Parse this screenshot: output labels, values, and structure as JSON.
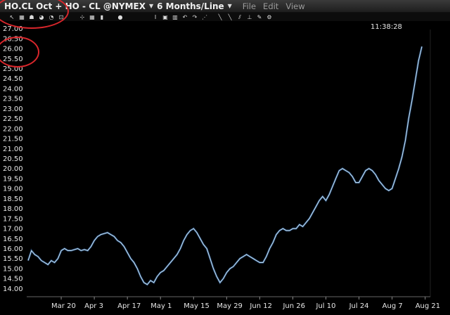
{
  "window": {
    "symbol": "HO.CL Oct + HO - CL @NYMEX",
    "period": "6 Months/Line",
    "menu": [
      "File",
      "Edit",
      "View"
    ]
  },
  "toolbar": {
    "icons": [
      "cursor-icon",
      "grid-icon",
      "drawing-icon",
      "paint-icon",
      "zoom-icon",
      "template-icon",
      "crosshair-icon",
      "table-icon",
      "bar-chart-icon",
      "globe-icon",
      "text-icon",
      "window-icon",
      "columns-icon",
      "undo-icon",
      "redo-icon",
      "trend-icon",
      "fib-icon",
      "line-icon",
      "channel-icon",
      "measure-icon",
      "tools-icon",
      "settings-icon"
    ]
  },
  "clock": "11:38:28",
  "colors": {
    "line": "#b9dbf5",
    "background": "#000000",
    "annotation": "#d8262b"
  },
  "chart_data": {
    "type": "line",
    "title": "",
    "xlabel": "",
    "ylabel": "",
    "ylim": [
      13.6,
      27.3
    ],
    "yticks": [
      14.0,
      14.5,
      15.0,
      15.5,
      16.0,
      16.5,
      17.0,
      17.5,
      18.0,
      18.5,
      19.0,
      19.5,
      20.0,
      20.5,
      21.0,
      21.5,
      22.0,
      22.5,
      23.0,
      23.5,
      24.0,
      24.5,
      25.0,
      25.5,
      26.0,
      26.5,
      27.0
    ],
    "ytick_labels": [
      "14.00",
      "14.50",
      "15.00",
      "15.50",
      "16.00",
      "16.50",
      "17.00",
      "17.50",
      "18.00",
      "18.50",
      "19.00",
      "19.50",
      "20.00",
      "20.50",
      "21.00",
      "21.50",
      "22.00",
      "22.50",
      "23.00",
      "23.50",
      "24.00",
      "24.50",
      "25.00",
      "25.50",
      "26.00",
      "26.50",
      "27.00"
    ],
    "xticks": [
      {
        "label": "Mar 20",
        "index": 10
      },
      {
        "label": "Apr 3",
        "index": 20
      },
      {
        "label": "Apr 17",
        "index": 30
      },
      {
        "label": "May 1",
        "index": 40
      },
      {
        "label": "May 15",
        "index": 50
      },
      {
        "label": "May 29",
        "index": 60
      },
      {
        "label": "Jun 12",
        "index": 70
      },
      {
        "label": "Jun 26",
        "index": 80
      },
      {
        "label": "Jul 10",
        "index": 90
      },
      {
        "label": "Jul 24",
        "index": 100
      },
      {
        "label": "Aug 7",
        "index": 110
      },
      {
        "label": "Aug 21",
        "index": 120
      }
    ],
    "series": [
      {
        "values": [
          15.4,
          15.9,
          15.7,
          15.6,
          15.4,
          15.3,
          15.2,
          15.4,
          15.3,
          15.5,
          15.9,
          16.0,
          15.9,
          15.9,
          15.95,
          16.0,
          15.9,
          15.95,
          15.9,
          16.1,
          16.4,
          16.6,
          16.7,
          16.75,
          16.8,
          16.7,
          16.6,
          16.4,
          16.3,
          16.1,
          15.8,
          15.5,
          15.3,
          15.0,
          14.6,
          14.3,
          14.2,
          14.4,
          14.3,
          14.6,
          14.8,
          14.9,
          15.1,
          15.3,
          15.5,
          15.7,
          16.0,
          16.4,
          16.7,
          16.9,
          17.0,
          16.8,
          16.5,
          16.2,
          16.0,
          15.5,
          15.0,
          14.6,
          14.3,
          14.5,
          14.8,
          15.0,
          15.1,
          15.3,
          15.5,
          15.6,
          15.7,
          15.6,
          15.5,
          15.4,
          15.3,
          15.3,
          15.6,
          16.0,
          16.3,
          16.7,
          16.9,
          17.0,
          16.9,
          16.9,
          17.0,
          17.0,
          17.2,
          17.1,
          17.3,
          17.5,
          17.8,
          18.1,
          18.4,
          18.6,
          18.4,
          18.7,
          19.1,
          19.5,
          19.9,
          20.0,
          19.9,
          19.8,
          19.6,
          19.3,
          19.3,
          19.6,
          19.9,
          20.0,
          19.9,
          19.7,
          19.4,
          19.2,
          19.0,
          18.9,
          19.0,
          19.5,
          20.0,
          20.6,
          21.4,
          22.5,
          23.4,
          24.4,
          25.4,
          26.1
        ],
        "last": 26.1
      }
    ]
  }
}
